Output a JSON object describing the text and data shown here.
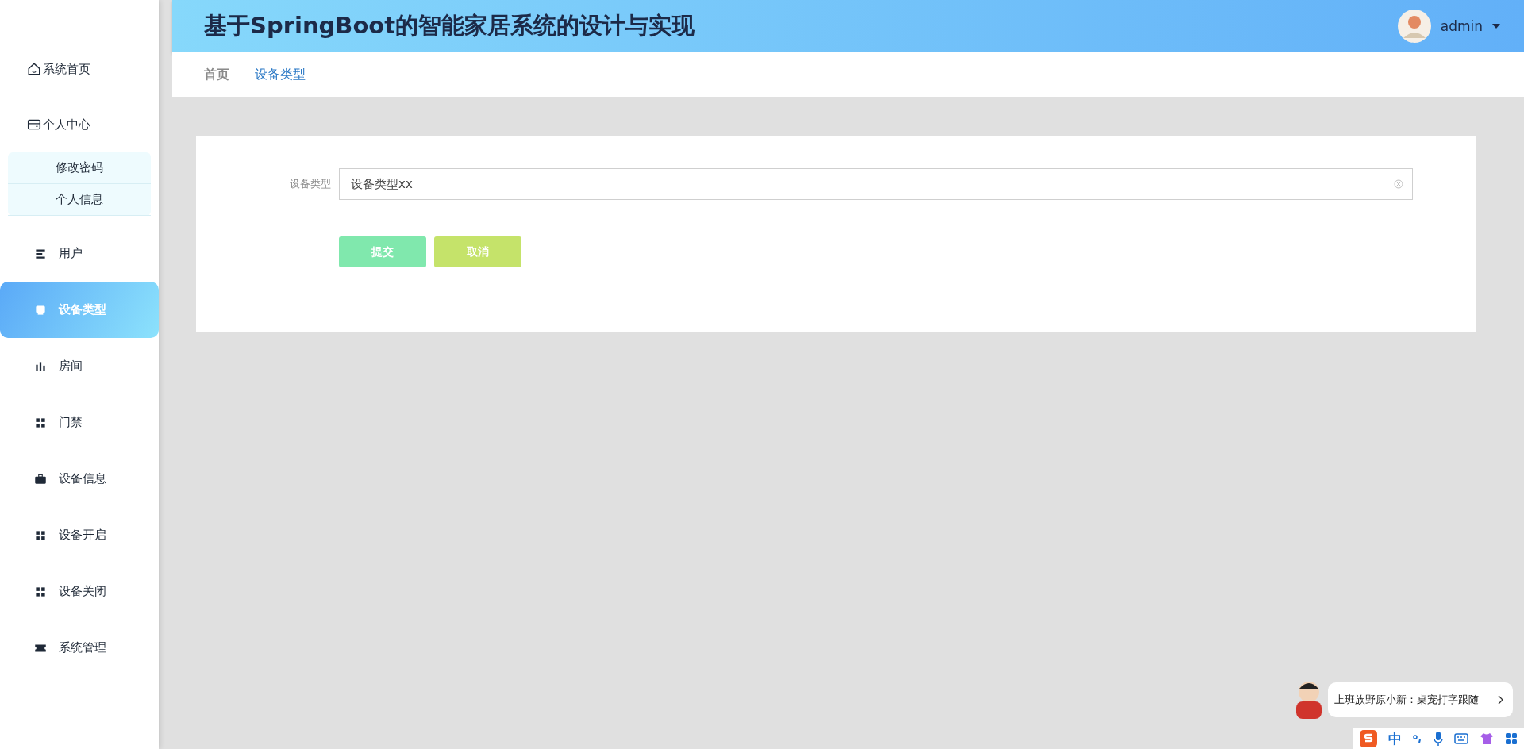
{
  "header": {
    "title": "基于SpringBoot的智能家居系统的设计与实现",
    "user": {
      "name": "admin"
    }
  },
  "sidebar": {
    "items": [
      {
        "label": "系统首页",
        "selected": false
      },
      {
        "label": "个人中心",
        "selected": false,
        "expanded": true,
        "children": [
          {
            "label": "修改密码",
            "selected": false
          },
          {
            "label": "个人信息",
            "selected": false
          }
        ]
      },
      {
        "label": "用户",
        "selected": false
      },
      {
        "label": "设备类型",
        "selected": true
      },
      {
        "label": "房间",
        "selected": false
      },
      {
        "label": "门禁",
        "selected": false
      },
      {
        "label": "设备信息",
        "selected": false
      },
      {
        "label": "设备开启",
        "selected": false
      },
      {
        "label": "设备关闭",
        "selected": false
      },
      {
        "label": "系统管理",
        "selected": false
      }
    ]
  },
  "breadcrumb": [
    {
      "label": "首页",
      "current": false
    },
    {
      "label": "设备类型",
      "current": true
    }
  ],
  "form": {
    "fields": [
      {
        "label": "设备类型",
        "value": "设备类型xx"
      }
    ],
    "buttons": [
      {
        "label": "提交",
        "kind": "submit"
      },
      {
        "label": "取消",
        "kind": "cancel"
      }
    ]
  },
  "desktop_pet": {
    "message": "上班族野原小新：桌宠打字跟随"
  },
  "ime_toolbar": {
    "mode": "中"
  }
}
